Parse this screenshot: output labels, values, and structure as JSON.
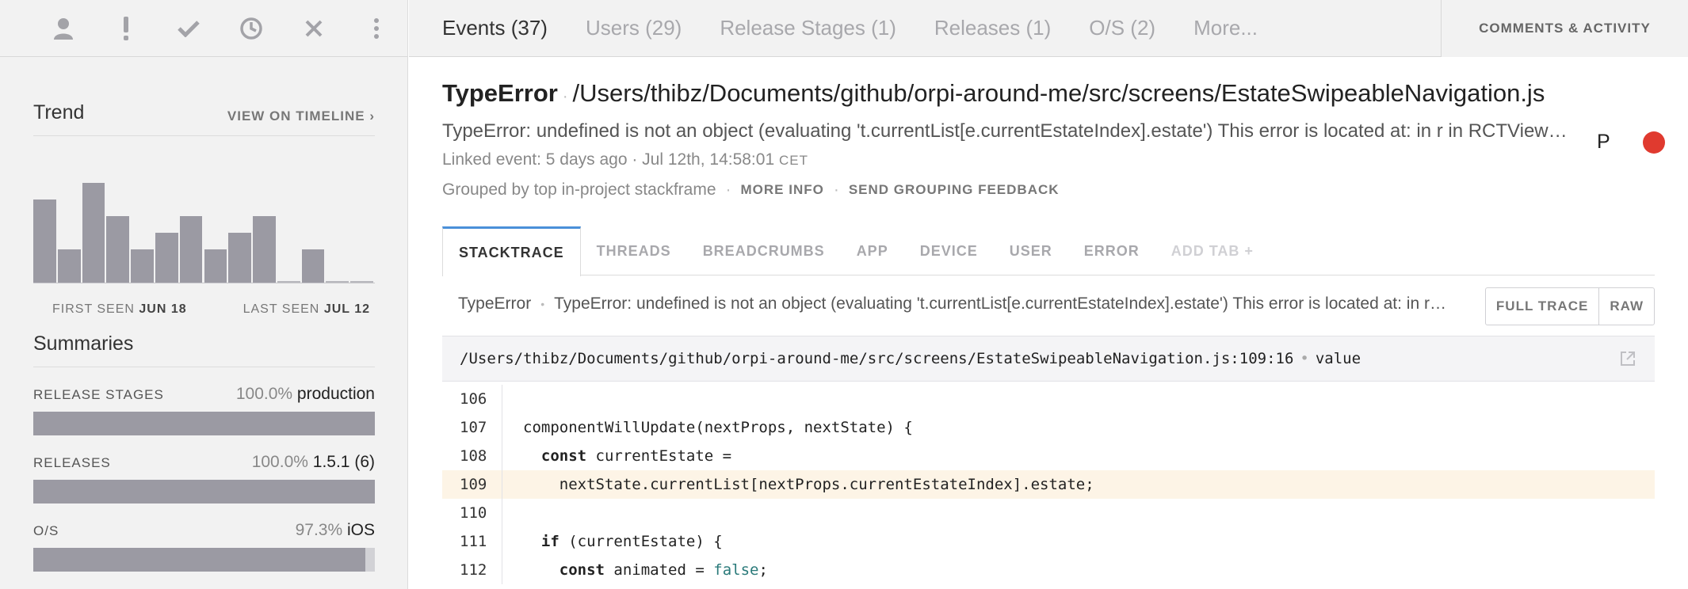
{
  "toolbar": {
    "icons": [
      "user-icon",
      "exclamation-icon",
      "check-icon",
      "clock-icon",
      "close-icon",
      "more-vertical-icon"
    ]
  },
  "trend": {
    "title": "Trend",
    "link": "VIEW ON TIMELINE ›",
    "first_seen_label": "FIRST SEEN",
    "first_seen_value": "JUN 18",
    "last_seen_label": "LAST SEEN",
    "last_seen_value": "JUL 12",
    "bar_values": [
      5,
      2,
      6,
      4,
      2,
      3,
      4,
      2,
      3,
      4,
      0,
      2,
      0,
      0
    ],
    "bar_max": 6
  },
  "summaries": {
    "title": "Summaries",
    "rows": [
      {
        "label": "RELEASE STAGES",
        "pct": "100.0%",
        "value": "production",
        "fill": 1.0
      },
      {
        "label": "RELEASES",
        "pct": "100.0%",
        "value": "1.5.1 (6)",
        "fill": 1.0
      },
      {
        "label": "O/S",
        "pct": "97.3%",
        "value": "iOS",
        "fill": 0.973
      }
    ]
  },
  "tabs": {
    "events": "Events (37)",
    "users": "Users (29)",
    "release_stages": "Release Stages (1)",
    "releases": "Releases (1)",
    "os": "O/S (2)",
    "more": "More...",
    "comments": "COMMENTS & ACTIVITY"
  },
  "error": {
    "class": "TypeError",
    "location": "/Users/thibz/Documents/github/orpi-around-me/src/screens/EstateSwipeableNavigation.js",
    "message": "TypeError: undefined is not an object (evaluating 't.currentList[e.currentEstateIndex].estate') This error is located at: in r in RCTView in RCTView in RCTScrollView",
    "linked_event": "Linked event: 5 days ago · Jul 12th, 14:58:01",
    "timezone": "CET",
    "grouped_by": "Grouped by top in-project stackframe",
    "more_info": "MORE INFO",
    "send_feedback": "SEND GROUPING FEEDBACK",
    "assignee_initial": "P",
    "status_color": "#e03a2f"
  },
  "detail_tabs": {
    "stacktrace": "STACKTRACE",
    "threads": "THREADS",
    "breadcrumbs": "BREADCRUMBS",
    "app": "APP",
    "device": "DEVICE",
    "user": "USER",
    "error": "ERROR",
    "add_tab": "ADD TAB +"
  },
  "trace": {
    "class": "TypeError",
    "message": "TypeError: undefined is not an object (evaluating 't.currentList[e.currentEstateIndex].estate') This error is located at: in r in RCTView",
    "full_trace": "FULL TRACE",
    "raw": "RAW",
    "frame_path": "/Users/thibz/Documents/github/orpi-around-me/src/screens/EstateSwipeableNavigation.js:109:16",
    "frame_method": "value"
  },
  "code": {
    "lines": [
      {
        "no": "106",
        "pre": "",
        "kw": "",
        "rest": "",
        "lit": "",
        "post": "",
        "highlight": false
      },
      {
        "no": "107",
        "pre": "componentWillUpdate(nextProps, nextState) {",
        "kw": "",
        "rest": "",
        "lit": "",
        "post": "",
        "highlight": false
      },
      {
        "no": "108",
        "pre": "  ",
        "kw": "const",
        "rest": " currentEstate =",
        "lit": "",
        "post": "",
        "highlight": false
      },
      {
        "no": "109",
        "pre": "    nextState.currentList[nextProps.currentEstateIndex].estate;",
        "kw": "",
        "rest": "",
        "lit": "",
        "post": "",
        "highlight": true
      },
      {
        "no": "110",
        "pre": "",
        "kw": "",
        "rest": "",
        "lit": "",
        "post": "",
        "highlight": false
      },
      {
        "no": "111",
        "pre": "  ",
        "kw": "if",
        "rest": " (currentEstate) {",
        "lit": "",
        "post": "",
        "highlight": false
      },
      {
        "no": "112",
        "pre": "    ",
        "kw": "const",
        "rest": " animated = ",
        "lit": "false",
        "post": ";",
        "highlight": false
      }
    ]
  }
}
